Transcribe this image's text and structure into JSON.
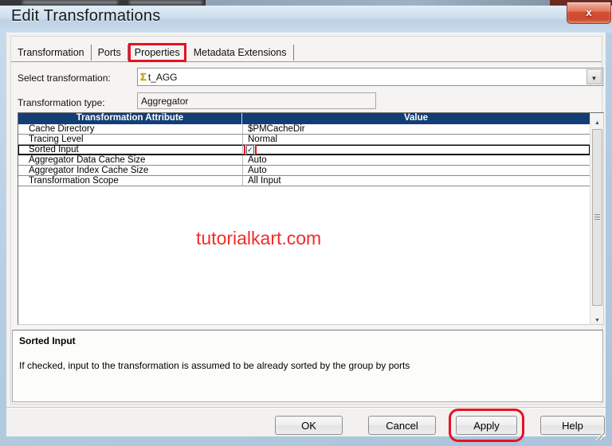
{
  "window": {
    "title": "Edit Transformations",
    "close_glyph": "x"
  },
  "tabs": [
    {
      "label": "Transformation"
    },
    {
      "label": "Ports"
    },
    {
      "label": "Properties",
      "highlighted": true
    },
    {
      "label": "Metadata Extensions"
    }
  ],
  "form": {
    "select_transformation_label": "Select transformation:",
    "selected_transformation": "t_AGG",
    "transformation_type_label": "Transformation type:",
    "transformation_type_value": "Aggregator"
  },
  "attributes_table": {
    "columns": [
      "Transformation Attribute",
      "Value"
    ],
    "rows": [
      {
        "attribute": "Cache Directory",
        "value": "$PMCacheDir"
      },
      {
        "attribute": "Tracing Level",
        "value": "Normal"
      },
      {
        "attribute": "Sorted Input",
        "value": "",
        "checkbox": true,
        "checked": true,
        "selected": true,
        "highlighted": true
      },
      {
        "attribute": "Aggregator Data Cache Size",
        "value": "Auto"
      },
      {
        "attribute": "Aggregator Index Cache Size",
        "value": "Auto"
      },
      {
        "attribute": "Transformation Scope",
        "value": "All Input"
      }
    ]
  },
  "watermark": "tutorialkart.com",
  "description": {
    "title": "Sorted Input",
    "text": "If checked, input to the transformation is assumed to be already sorted by the group by ports"
  },
  "buttons": [
    {
      "label": "OK",
      "key": "ok"
    },
    {
      "label": "Cancel",
      "key": "cancel"
    },
    {
      "label": "Apply",
      "key": "apply",
      "highlighted": true
    },
    {
      "label": "Help",
      "key": "help"
    }
  ],
  "icons": {
    "close_icon": "✕",
    "dropdown_arrow_icon": "▼",
    "scroll_up_icon": "▲",
    "scroll_down_icon": "▼",
    "aggregator_sigma_icon": "Σ",
    "check_icon": "✓"
  },
  "colors": {
    "annotation_red": "#e81123",
    "table_header_navy": "#123e75",
    "watermark_red": "#f32b2b",
    "close_button_red": "#cf4a2e",
    "titlebar_blue": "#cdddec"
  }
}
